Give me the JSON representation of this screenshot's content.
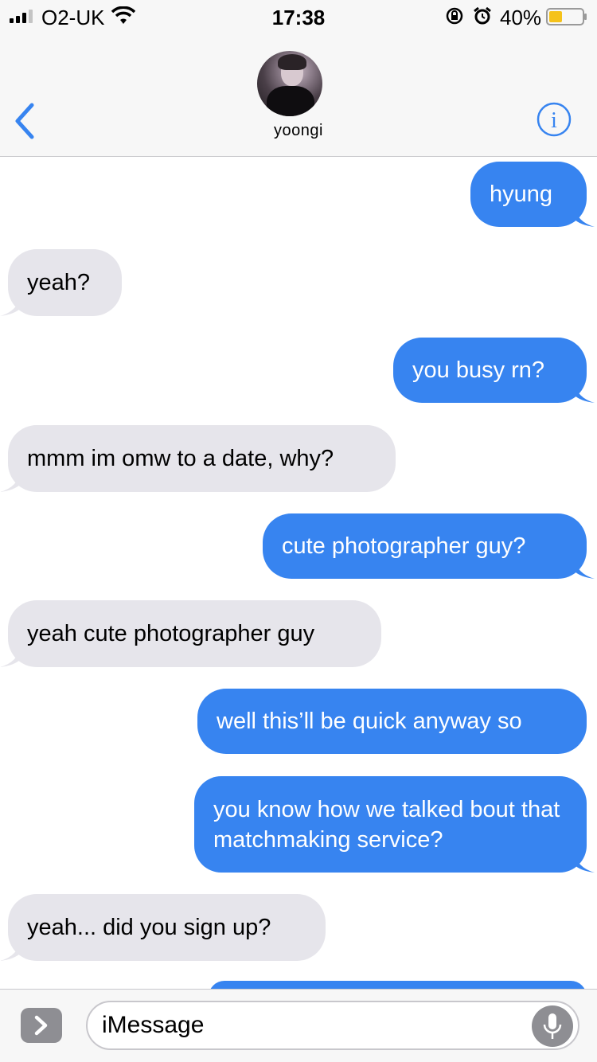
{
  "status_bar": {
    "carrier": "O2-UK",
    "time": "17:38",
    "battery_percent": "40%",
    "battery_level": 0.4,
    "battery_color": "#f5c21a",
    "icons": [
      "signal-icon",
      "wifi-icon",
      "rotation-lock-icon",
      "alarm-icon",
      "battery-icon"
    ]
  },
  "nav": {
    "contact_name": "yoongi",
    "back_icon": "chevron-left-icon",
    "info_icon": "info-icon",
    "accent": "#3784f0"
  },
  "messages": [
    {
      "from": "me",
      "text": "hyung"
    },
    {
      "from": "them",
      "text": "yeah?"
    },
    {
      "from": "me",
      "text": "you busy rn?"
    },
    {
      "from": "them",
      "text": "mmm im omw to a date, why?"
    },
    {
      "from": "me",
      "text": "cute photographer guy?"
    },
    {
      "from": "them",
      "text": "yeah cute photographer guy"
    },
    {
      "from": "me",
      "text": "well this’ll be quick anyway so"
    },
    {
      "from": "me",
      "text": "you know how we talked bout that matchmaking service?"
    },
    {
      "from": "them",
      "text": "yeah... did you sign up?"
    }
  ],
  "composer": {
    "placeholder": "iMessage",
    "apps_icon": "chevron-right-icon",
    "mic_icon": "microphone-icon"
  },
  "colors": {
    "sent_bubble": "#3784f0",
    "received_bubble": "#e6e5eb",
    "bar_background": "#f7f7f7"
  }
}
